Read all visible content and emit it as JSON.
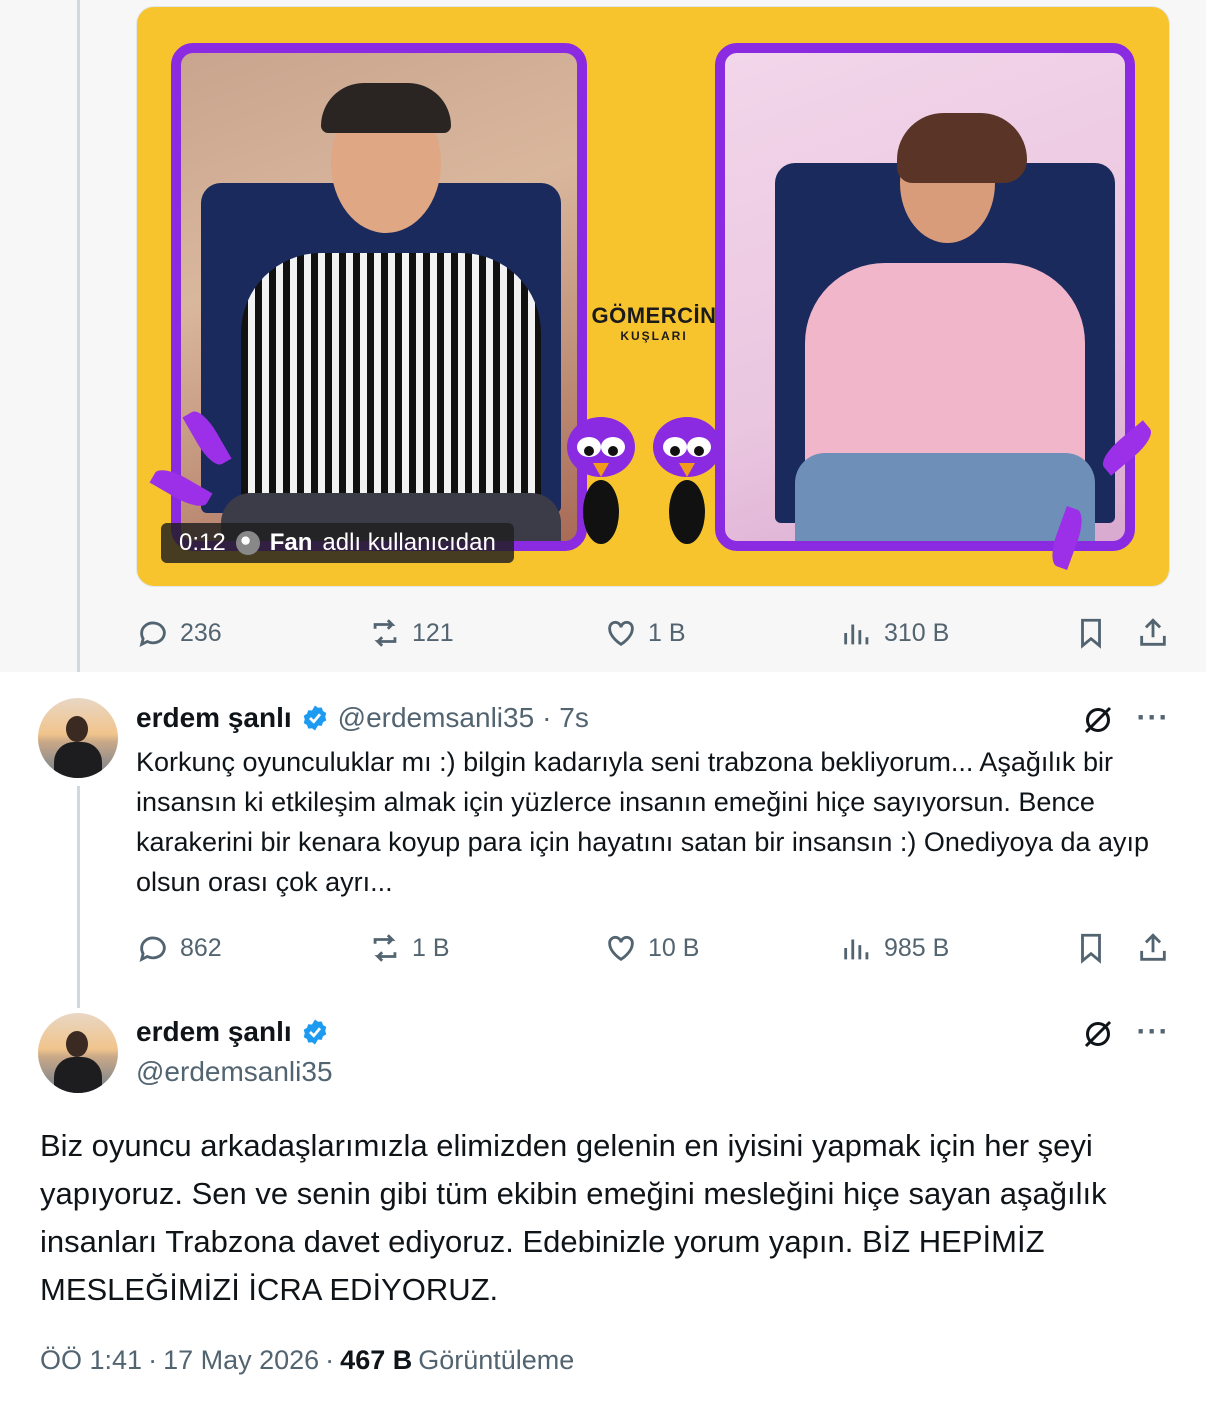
{
  "media": {
    "brand_line1": "GÖMERCİN",
    "brand_line2": "KUŞLARI",
    "caption_time": "0:12",
    "caption_user": "Fan",
    "caption_suffix": "adlı kullanıcıdan"
  },
  "quoted_actions": {
    "replies": "236",
    "reposts": "121",
    "likes": "1 B",
    "views": "310 B"
  },
  "reply_tweet": {
    "name": "erdem şanlı",
    "handle": "@erdemsanli35",
    "time": "· 7s",
    "text": "Korkunç oyunculuklar mı :) bilgin kadarıyla seni trabzona bekliyorum... Aşağılık bir insansın ki etkileşim almak için yüzlerce insanın emeğini hiçe sayıyorsun. Bence karakerini bir kenara koyup para için hayatını satan bir insansın :) Onediyoya da ayıp olsun orası çok ayrı...",
    "replies": "862",
    "reposts": "1 B",
    "likes": "10 B",
    "views": "985 B"
  },
  "main_tweet": {
    "name": "erdem şanlı",
    "handle": "@erdemsanli35",
    "text": "Biz oyuncu arkadaşlarımızla elimizden gelenin en iyisini yapmak için her şeyi yapıyoruz. Sen ve senin gibi tüm ekibin emeğini mesleğini hiçe sayan aşağılık insanları Trabzona davet ediyoruz. Edebinizle yorum yapın. BİZ HEPİMİZ MESLEĞİMİZİ İCRA EDİYORUZ.",
    "time": "ÖÖ 1:41",
    "sep": "·",
    "date": "17 May 2026",
    "views_count": "467 B",
    "views_label": "Görüntüleme"
  },
  "colors": {
    "verified_blue": "#1d9bf0",
    "muted": "#536471",
    "media_yellow": "#f8c42e",
    "frame_purple": "#8a2be2"
  },
  "icons": [
    "reply-icon",
    "repost-icon",
    "like-icon",
    "views-icon",
    "bookmark-icon",
    "share-icon",
    "grok-icon",
    "more-icon",
    "verified-badge-icon",
    "globe-icon"
  ]
}
